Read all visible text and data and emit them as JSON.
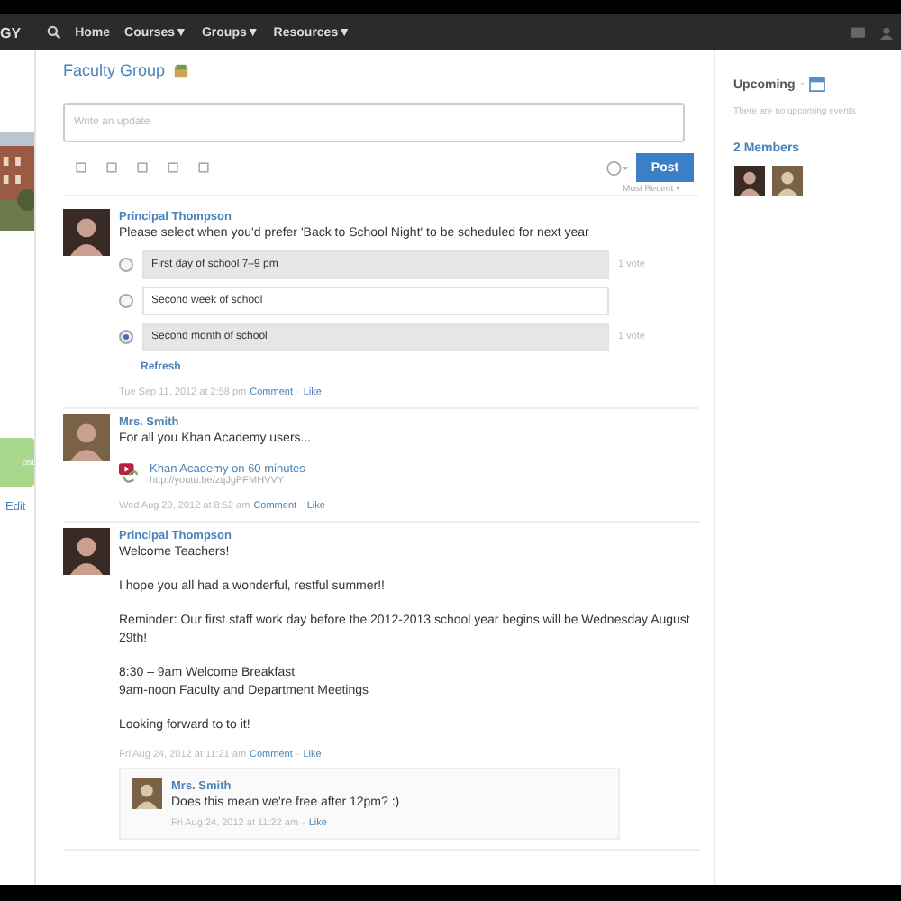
{
  "nav": {
    "logo": "GY",
    "items": [
      {
        "label": "Home",
        "dropdown": false
      },
      {
        "label": "Courses",
        "dropdown": true
      },
      {
        "label": "Groups",
        "dropdown": true
      },
      {
        "label": "Resources",
        "dropdown": true
      }
    ],
    "caret": "▼"
  },
  "left": {
    "button": "ost",
    "link": "Edit"
  },
  "group": {
    "title": "Faculty Group"
  },
  "composer": {
    "placeholder": "Write an update",
    "post_button": "Post",
    "sort": "Most Recent ▾"
  },
  "posts": [
    {
      "kind": "poll",
      "author": "Principal Thompson",
      "text": "Please select when you'd prefer 'Back to School Night' to be scheduled for next year",
      "options": [
        {
          "label": "First day of school 7–9 pm",
          "selected": false,
          "voted": true,
          "votes": "1 vote"
        },
        {
          "label": "Second week of school",
          "selected": false,
          "voted": false
        },
        {
          "label": "Second month of school",
          "selected": true,
          "voted": true,
          "votes": "1 vote"
        }
      ],
      "refresh": "Refresh",
      "timestamp": "Tue Sep 11, 2012 at 2:58 pm",
      "actions": [
        "Comment",
        "Like"
      ]
    },
    {
      "kind": "link",
      "author": "Mrs. Smith",
      "text": "For all you Khan Academy users...",
      "link": {
        "title": "Khan Academy on 60 minutes",
        "url": "http://youtu.be/zqJgPFMHVVY"
      },
      "timestamp": "Wed Aug 29, 2012 at 8:52 am",
      "actions": [
        "Comment",
        "Like"
      ]
    },
    {
      "kind": "text",
      "author": "Principal Thompson",
      "paragraphs": [
        "Welcome Teachers!",
        "I hope you all had a wonderful, restful summer!!",
        "Reminder: Our first staff work day before the 2012-2013 school year begins will be Wednesday August 29th!",
        "8:30 – 9am Welcome Breakfast\n9am-noon Faculty and Department Meetings",
        "Looking forward to to it!"
      ],
      "timestamp": "Fri Aug 24, 2012 at 11:21 am",
      "actions": [
        "Comment",
        "Like"
      ],
      "comments": [
        {
          "author": "Mrs. Smith",
          "text": "Does this mean we're free after 12pm? :)",
          "timestamp": "Fri Aug 24, 2012 at 11:22 am",
          "actions": [
            "Like"
          ]
        }
      ]
    }
  ],
  "separator": "·",
  "right": {
    "upcoming": "Upcoming",
    "upcoming_sep": "-",
    "empty": "There are no upcoming events",
    "members": "2 Members"
  }
}
